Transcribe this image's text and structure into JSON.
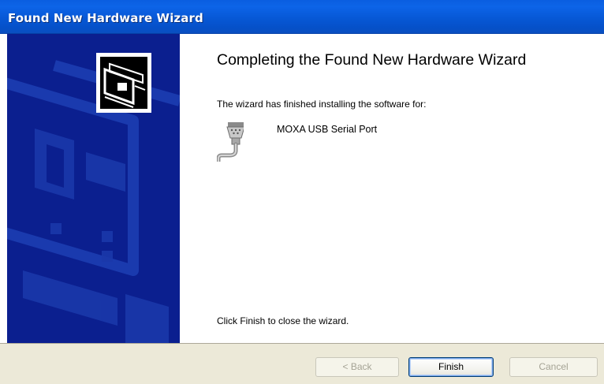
{
  "window": {
    "title": "Found New Hardware Wizard"
  },
  "main": {
    "heading": "Completing the Found New Hardware Wizard",
    "subtitle": "The wizard has finished installing the software for:",
    "device_icon": "serial-port-icon",
    "device_name": "MOXA USB Serial Port",
    "finish_hint": "Click Finish to close the wizard."
  },
  "side_panel": {
    "graphic": "hardware-card-icon",
    "background_color": "#0a1e8c"
  },
  "buttons": {
    "back_label": "< Back",
    "back_enabled": false,
    "finish_label": "Finish",
    "cancel_label": "Cancel",
    "cancel_enabled": false
  },
  "colors": {
    "titlebar": "#0758d6",
    "button_bar": "#ece9d8"
  }
}
